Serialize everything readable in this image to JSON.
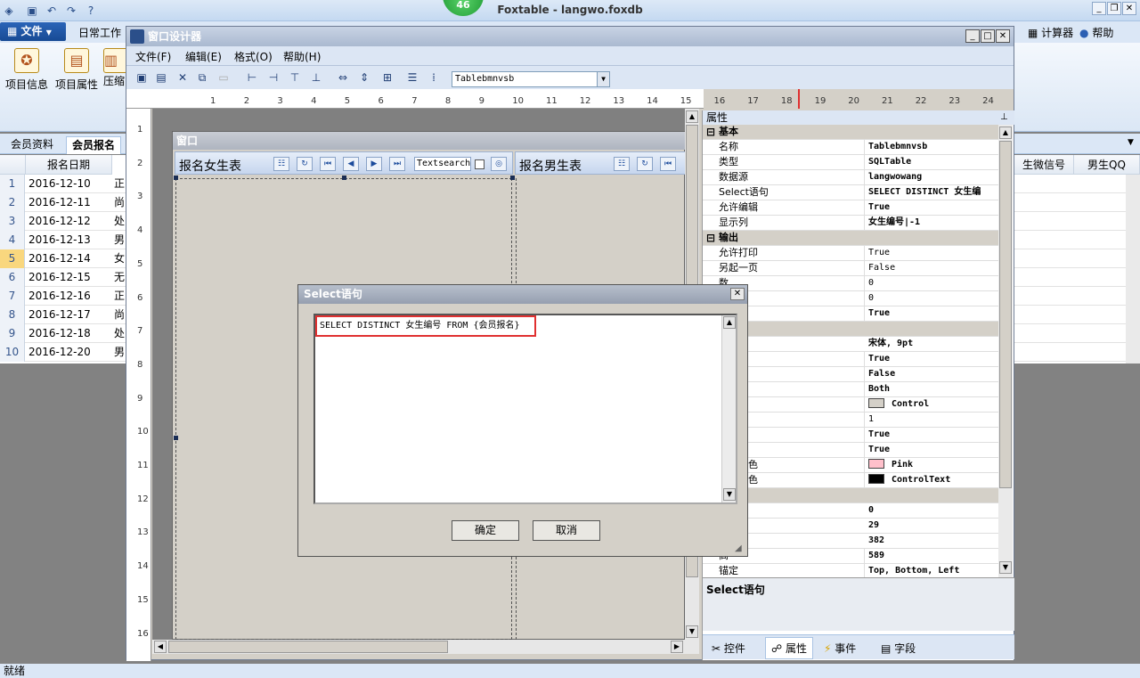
{
  "app": {
    "title": "Foxtable - langwo.foxdb",
    "notification_count": "46",
    "file_tab": "文件",
    "ribbon_tab": "日常工作",
    "right_tools": [
      "计算器",
      "帮助"
    ],
    "ribbon_buttons": [
      "项目信息",
      "项目属性",
      "压缩"
    ],
    "subtabs": [
      "会员资料",
      "会员报名"
    ],
    "grid_headers": [
      "报名日期",
      "生微信号",
      "男生QQ"
    ],
    "rows": [
      {
        "num": "1",
        "date": "2016-12-10",
        "c": "正"
      },
      {
        "num": "2",
        "date": "2016-12-11",
        "c": "尚"
      },
      {
        "num": "3",
        "date": "2016-12-12",
        "c": "处"
      },
      {
        "num": "4",
        "date": "2016-12-13",
        "c": "男"
      },
      {
        "num": "5",
        "date": "2016-12-14",
        "c": "女"
      },
      {
        "num": "6",
        "date": "2016-12-15",
        "c": "无"
      },
      {
        "num": "7",
        "date": "2016-12-16",
        "c": "正"
      },
      {
        "num": "8",
        "date": "2016-12-17",
        "c": "尚"
      },
      {
        "num": "9",
        "date": "2016-12-18",
        "c": "处"
      },
      {
        "num": "10",
        "date": "2016-12-20",
        "c": "男"
      }
    ],
    "status": "就绪"
  },
  "designer": {
    "title": "窗口设计器",
    "menu": [
      "文件(F)",
      "编辑(E)",
      "格式(O)",
      "帮助(H)"
    ],
    "combo_value": "Tablebmnvsb",
    "ruler_h": [
      "1",
      "2",
      "3",
      "4",
      "5",
      "6",
      "7",
      "8",
      "9",
      "10",
      "11",
      "12",
      "13",
      "14",
      "15",
      "16",
      "17",
      "18",
      "19",
      "20",
      "21",
      "22",
      "23",
      "24"
    ],
    "ruler_v": [
      "1",
      "2",
      "3",
      "4",
      "5",
      "6",
      "7",
      "8",
      "9",
      "10",
      "11",
      "12",
      "13",
      "14",
      "15",
      "16"
    ],
    "form_title": "窗口",
    "panel_left_title": "报名女生表",
    "panel_right_title": "报名男生表",
    "textsearch": "Textsearch"
  },
  "properties": {
    "header": "属性",
    "rows": [
      {
        "cat": true,
        "name": "基本",
        "value": ""
      },
      {
        "name": "名称",
        "value": "Tablebmnvsb",
        "bold": true
      },
      {
        "name": "类型",
        "value": "SQLTable",
        "bold": true
      },
      {
        "name": "数据源",
        "value": "langwowang",
        "bold": true
      },
      {
        "name": "Select语句",
        "value": "SELECT DISTINCT 女生编",
        "bold": true
      },
      {
        "name": "允许编辑",
        "value": "True",
        "bold": true
      },
      {
        "name": "显示列",
        "value": "女生编号|-1",
        "bold": true
      },
      {
        "cat": true,
        "name": "输出",
        "value": ""
      },
      {
        "name": "允许打印",
        "value": "True"
      },
      {
        "name": "另起一页",
        "value": "False"
      },
      {
        "name": "数",
        "value": "0"
      },
      {
        "name": "数",
        "value": "0"
      },
      {
        "name": "号",
        "value": "True",
        "bold": true
      },
      {
        "cat": true,
        "name": "",
        "value": ""
      },
      {
        "name": "",
        "value": "宋体, 9pt",
        "bold": true
      },
      {
        "name": "号列",
        "value": "True",
        "bold": true
      },
      {
        "name": "选框",
        "value": "False",
        "bold": true
      },
      {
        "name": "方向",
        "value": "Both",
        "bold": true
      },
      {
        "name": "颜色",
        "value": "Control",
        "bold": true,
        "swatch": "#d4d0c8"
      },
      {
        "name": "宽度",
        "value": "1"
      },
      {
        "name": "出",
        "value": "True",
        "bold": true
      },
      {
        "name": "点框",
        "value": "True",
        "bold": true
      },
      {
        "name": "背景颜色",
        "value": "Pink",
        "bold": true,
        "swatch": "#ffc0cb"
      },
      {
        "name": "字体颜色",
        "value": "ControlText",
        "bold": true,
        "swatch": "#000000"
      },
      {
        "cat": true,
        "name": "",
        "value": ""
      },
      {
        "name": "",
        "value": "0",
        "bold": true
      },
      {
        "name": "",
        "value": "29",
        "bold": true
      },
      {
        "name": "",
        "value": "382",
        "bold": true
      },
      {
        "name": "高",
        "value": "589",
        "bold": true
      },
      {
        "name": "锚定",
        "value": "Top, Bottom, Left",
        "bold": true
      }
    ],
    "description": "Select语句",
    "tabs": [
      "控件",
      "属性",
      "事件",
      "字段"
    ]
  },
  "dialog": {
    "title": "Select语句",
    "sql": "SELECT DISTINCT 女生编号 FROM {会员报名}",
    "ok": "确定",
    "cancel": "取消"
  }
}
